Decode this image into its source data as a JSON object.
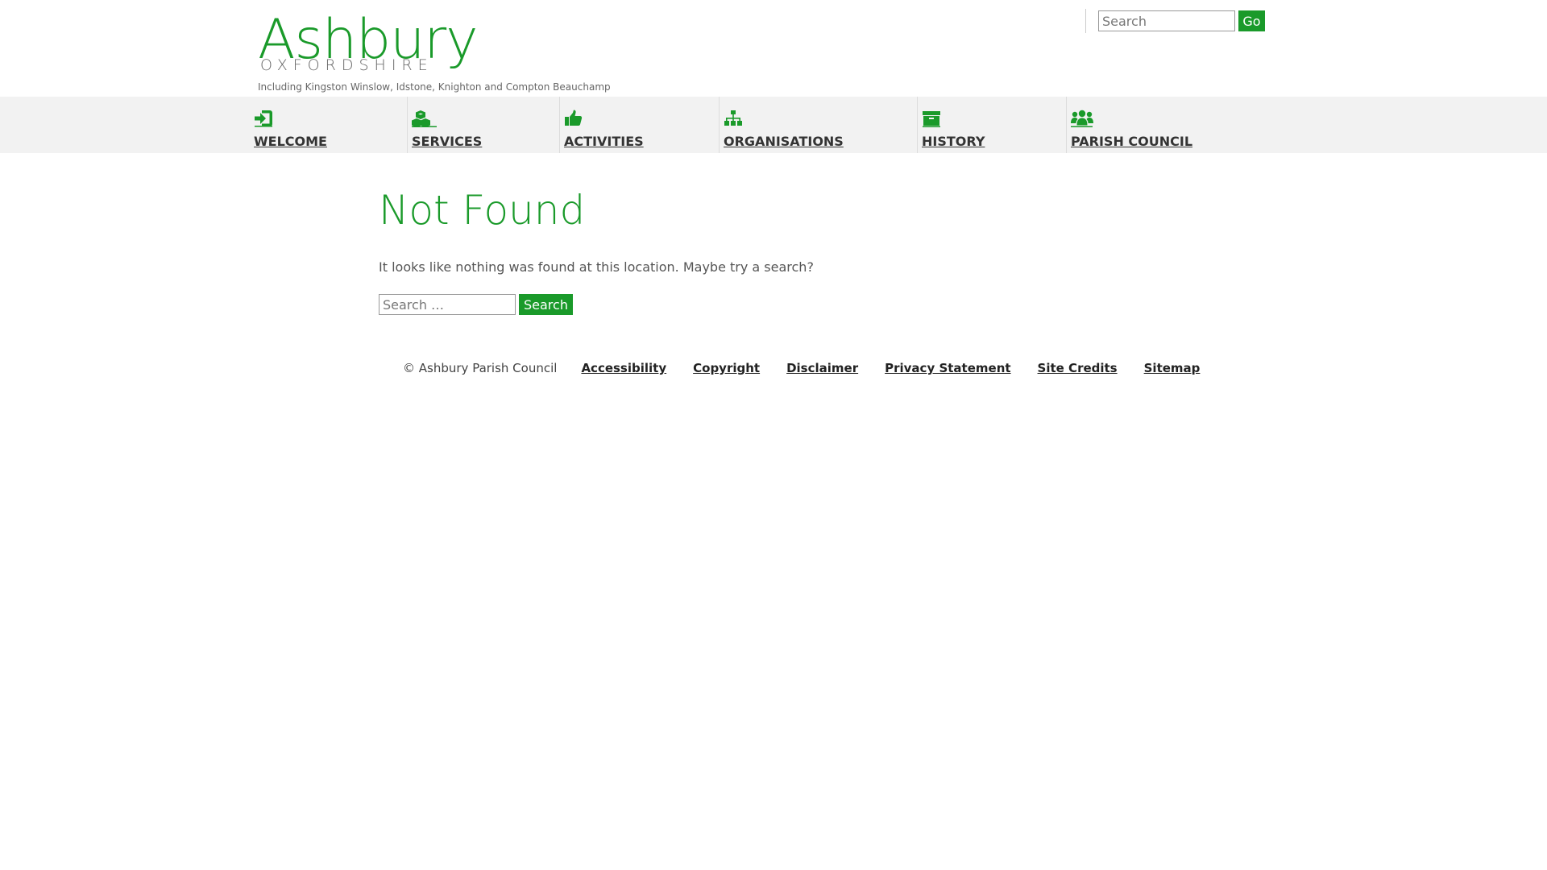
{
  "brand": {
    "name": "Ashbury",
    "county": "OXFORDSHIRE",
    "tagline": "Including Kingston Winslow, Idstone, Knighton and Compton Beauchamp"
  },
  "header_search": {
    "placeholder": "Search",
    "button_label": "Go"
  },
  "nav": {
    "items": [
      {
        "label": "WELCOME",
        "icon": "sign-in-icon"
      },
      {
        "label": "SERVICES",
        "icon": "cubes-icon"
      },
      {
        "label": "ACTIVITIES",
        "icon": "thumbs-up-icon"
      },
      {
        "label": "ORGANISATIONS",
        "icon": "sitemap-icon"
      },
      {
        "label": "HISTORY",
        "icon": "archive-icon"
      },
      {
        "label": "PARISH COUNCIL",
        "icon": "users-icon"
      }
    ]
  },
  "main": {
    "title": "Not Found",
    "message": "It looks like nothing was found at this location. Maybe try a search?",
    "search_placeholder": "Search …",
    "search_button": "Search"
  },
  "footer": {
    "copyright": "© Ashbury Parish Council",
    "links": [
      "Accessibility",
      "Copyright",
      "Disclaimer",
      "Privacy Statement",
      "Site Credits",
      "Sitemap"
    ]
  },
  "colors": {
    "accent": "#1a9a2a",
    "nav_background": "#f2f2f2",
    "text": "#333333"
  }
}
